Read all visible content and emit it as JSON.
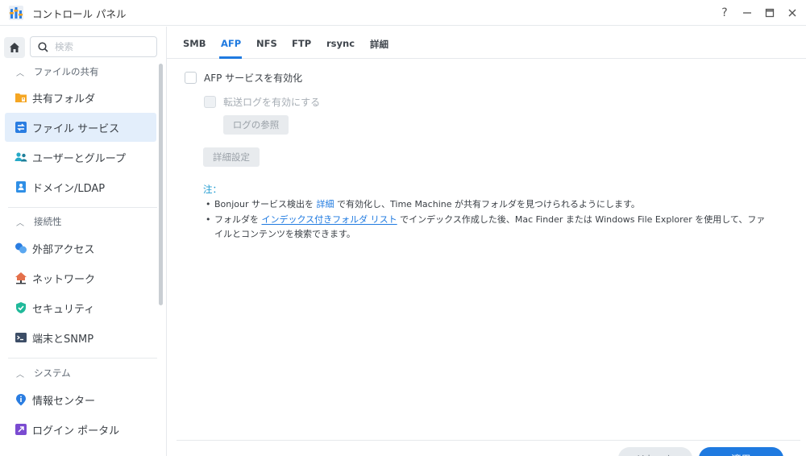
{
  "window": {
    "title": "コントロール パネル",
    "help": "?",
    "minimize": "—",
    "maximize": "▣",
    "close": "✕"
  },
  "sidebar": {
    "search_placeholder": "検索",
    "sections": [
      {
        "title": "ファイルの共有",
        "items": [
          {
            "label": "共有フォルダ",
            "icon": "folder-icon",
            "color": "#f5a623"
          },
          {
            "label": "ファイル サービス",
            "icon": "file-services-icon",
            "color": "#2a7de1",
            "active": true
          },
          {
            "label": "ユーザーとグループ",
            "icon": "users-icon",
            "color": "#26a9c7"
          },
          {
            "label": "ドメイン/LDAP",
            "icon": "domain-icon",
            "color": "#2f8fe6"
          }
        ]
      },
      {
        "title": "接続性",
        "items": [
          {
            "label": "外部アクセス",
            "icon": "external-access-icon",
            "color": "#2a7de1"
          },
          {
            "label": "ネットワーク",
            "icon": "network-icon",
            "color": "#e4704b"
          },
          {
            "label": "セキュリティ",
            "icon": "shield-icon",
            "color": "#20b99a"
          },
          {
            "label": "端末とSNMP",
            "icon": "terminal-icon",
            "color": "#3c4d66"
          }
        ]
      },
      {
        "title": "システム",
        "items": [
          {
            "label": "情報センター",
            "icon": "info-icon",
            "color": "#2a7de1"
          },
          {
            "label": "ログイン ポータル",
            "icon": "login-portal-icon",
            "color": "#7a4bd1"
          }
        ]
      }
    ]
  },
  "tabs": [
    {
      "label": "SMB"
    },
    {
      "label": "AFP",
      "active": true
    },
    {
      "label": "NFS"
    },
    {
      "label": "FTP"
    },
    {
      "label": "rsync"
    },
    {
      "label": "詳細"
    }
  ],
  "afp": {
    "enable_label": "AFP サービスを有効化",
    "log_label": "転送ログを有効にする",
    "view_log_button": "ログの参照",
    "advanced_button": "詳細設定"
  },
  "note": {
    "title": "注：",
    "line1_a": "Bonjour サービス検出を ",
    "line1_link": "詳細",
    "line1_b": " で有効化し、Time Machine が共有フォルダを見つけられるようにします。",
    "line2_a": "フォルダを ",
    "line2_link": "インデックス付きフォルダ リスト",
    "line2_b": " でインデックス作成した後、Mac Finder または Windows File Explorer を使用して、ファ",
    "line3": "イルとコンテンツを検索できます。"
  },
  "footer": {
    "reset_label": "リセット",
    "apply_label": "適用"
  },
  "colors": {
    "accent": "#1f7ae0",
    "active_bg": "#e3eefb"
  }
}
